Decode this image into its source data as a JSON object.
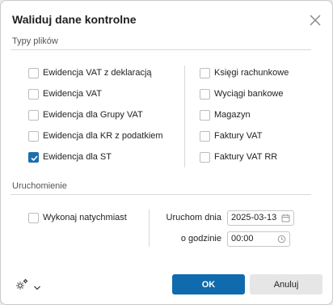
{
  "dialog": {
    "title": "Waliduj dane kontrolne",
    "close_icon": "close-icon"
  },
  "file_types": {
    "section_label": "Typy plików",
    "left": [
      {
        "label": "Ewidencja VAT z deklaracją",
        "checked": false
      },
      {
        "label": "Ewidencja VAT",
        "checked": false
      },
      {
        "label": "Ewidencja dla Grupy VAT",
        "checked": false
      },
      {
        "label": "Ewidencja dla KR z podatkiem",
        "checked": false
      },
      {
        "label": "Ewidencja dla ST",
        "checked": true
      }
    ],
    "right": [
      {
        "label": "Księgi rachunkowe",
        "checked": false
      },
      {
        "label": "Wyciągi bankowe",
        "checked": false
      },
      {
        "label": "Magazyn",
        "checked": false
      },
      {
        "label": "Faktury VAT",
        "checked": false
      },
      {
        "label": "Faktury VAT RR",
        "checked": false
      }
    ]
  },
  "launch": {
    "section_label": "Uruchomienie",
    "run_now_label": "Wykonaj natychmiast",
    "run_now_checked": false,
    "run_date_label": "Uruchom dnia",
    "run_date_value": "2025-03-13",
    "time_label": "o godzinie",
    "time_value": "00:00"
  },
  "footer": {
    "settings_icon": "gear-icon",
    "ok_label": "OK",
    "cancel_label": "Anuluj"
  },
  "colors": {
    "accent": "#0f6bad",
    "checkbox_checked": "#1a6fb0"
  }
}
